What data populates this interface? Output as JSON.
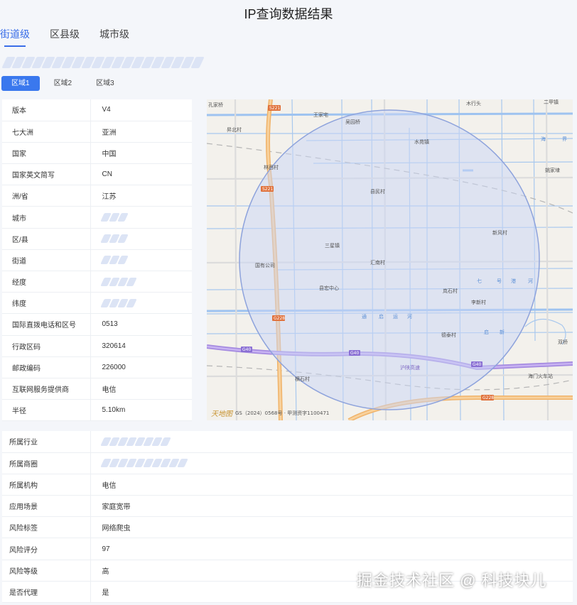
{
  "title": "IP查询数据结果",
  "level_tabs": [
    {
      "label": "街道级",
      "active": true
    },
    {
      "label": "区县级",
      "active": false
    },
    {
      "label": "城市级",
      "active": false
    }
  ],
  "region_tabs": [
    {
      "label": "区域1",
      "active": true
    },
    {
      "label": "区域2",
      "active": false
    },
    {
      "label": "区域3",
      "active": false
    }
  ],
  "info_rows": [
    {
      "key": "版本",
      "value": "V4"
    },
    {
      "key": "七大洲",
      "value": "亚洲"
    },
    {
      "key": "国家",
      "value": "中国"
    },
    {
      "key": "国家英文简写",
      "value": "CN"
    },
    {
      "key": "洲/省",
      "value": "江苏"
    },
    {
      "key": "城市",
      "value": ""
    },
    {
      "key": "区/县",
      "value": ""
    },
    {
      "key": "街道",
      "value": ""
    },
    {
      "key": "经度",
      "value": ""
    },
    {
      "key": "纬度",
      "value": ""
    },
    {
      "key": "国际直拨电话和区号",
      "value": "0513"
    },
    {
      "key": "行政区码",
      "value": "320614"
    },
    {
      "key": "邮政编码",
      "value": "226000"
    },
    {
      "key": "互联网服务提供商",
      "value": "电信"
    },
    {
      "key": "半径",
      "value": "5.10km"
    }
  ],
  "bottom_rows": [
    {
      "key": "所属行业",
      "value": ""
    },
    {
      "key": "所属商圈",
      "value": ""
    },
    {
      "key": "所属机构",
      "value": "电信"
    },
    {
      "key": "应用场景",
      "value": "家庭宽带"
    },
    {
      "key": "风险标签",
      "value": "网络爬虫"
    },
    {
      "key": "风险评分",
      "value": "97"
    },
    {
      "key": "风险等级",
      "value": "高"
    },
    {
      "key": "是否代理",
      "value": "是"
    }
  ],
  "map": {
    "places": [
      "孔家桥",
      "王家宅",
      "吴园桥",
      "木行头",
      "二甲镇",
      "昇北村",
      "水苑镇",
      "海",
      "界",
      "姚家埭",
      "林西村",
      "县民村",
      "新风村",
      "三星镇",
      "汇南村",
      "七",
      "号",
      "港",
      "河",
      "县宏中心",
      "国有公司",
      "岚石村",
      "李新村",
      "通",
      "启",
      "运",
      "河",
      "德泰村",
      "启",
      "新",
      "双桥",
      "海门火车站",
      "横石村"
    ],
    "road_labels": [
      "G40",
      "G40",
      "G40",
      "G228",
      "G228",
      "S221",
      "S221"
    ],
    "expressway_label": "沪陕高速",
    "logo": "天地图",
    "copyright": "GS（2024）0568号 · 甲测资字1100471"
  },
  "watermark": "掘金技术社区 @ 科技块儿",
  "colors": {
    "accent": "#3a6ee8",
    "circle_fill": "#c9d6f5",
    "circle_stroke": "#8ea3dc",
    "expressway": "#a58be0",
    "highway": "#f1b46a"
  }
}
